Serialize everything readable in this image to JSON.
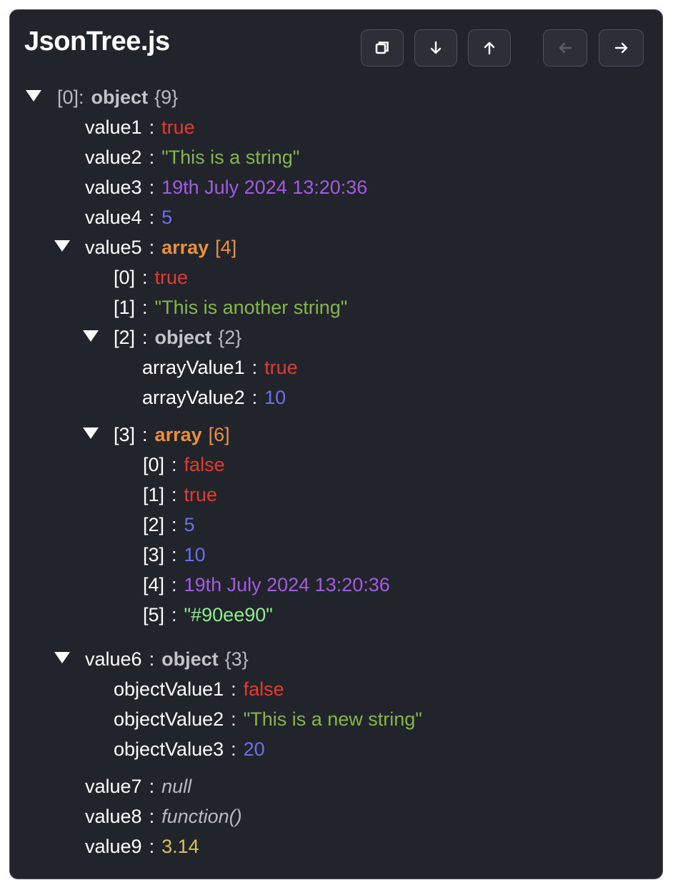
{
  "header": {
    "title": "JsonTree.js"
  },
  "toolbar": {
    "buttons": [
      {
        "name": "copy-button",
        "icon": "copy-icon",
        "enabled": true
      },
      {
        "name": "expand-all-button",
        "icon": "arrow-down-icon",
        "enabled": true
      },
      {
        "name": "collapse-all-button",
        "icon": "arrow-up-icon",
        "enabled": true
      },
      {
        "name": "previous-button",
        "icon": "arrow-left-icon",
        "enabled": false
      },
      {
        "name": "next-button",
        "icon": "arrow-right-icon",
        "enabled": true
      }
    ]
  },
  "tree": {
    "root": {
      "key": "[0]",
      "colon": ":",
      "type": "object",
      "count": "{9}"
    },
    "value1": {
      "key": "value1",
      "colon": ":",
      "value": "true"
    },
    "value2": {
      "key": "value2",
      "colon": ":",
      "value": "\"This is a string\""
    },
    "value3": {
      "key": "value3",
      "colon": ":",
      "value": "19th July 2024 13:20:36"
    },
    "value4": {
      "key": "value4",
      "colon": ":",
      "value": "5"
    },
    "value5": {
      "key": "value5",
      "colon": ":",
      "type": "array",
      "count": "[4]",
      "i0": {
        "key": "[0]",
        "colon": ":",
        "value": "true"
      },
      "i1": {
        "key": "[1]",
        "colon": ":",
        "value": "\"This is another string\""
      },
      "i2": {
        "key": "[2]",
        "colon": ":",
        "type": "object",
        "count": "{2}",
        "arrayValue1": {
          "key": "arrayValue1",
          "colon": ":",
          "value": "true"
        },
        "arrayValue2": {
          "key": "arrayValue2",
          "colon": ":",
          "value": "10"
        }
      },
      "i3": {
        "key": "[3]",
        "colon": ":",
        "type": "array",
        "count": "[6]",
        "j0": {
          "key": "[0]",
          "colon": ":",
          "value": "false"
        },
        "j1": {
          "key": "[1]",
          "colon": ":",
          "value": "true"
        },
        "j2": {
          "key": "[2]",
          "colon": ":",
          "value": "5"
        },
        "j3": {
          "key": "[3]",
          "colon": ":",
          "value": "10"
        },
        "j4": {
          "key": "[4]",
          "colon": ":",
          "value": "19th July 2024 13:20:36"
        },
        "j5": {
          "key": "[5]",
          "colon": ":",
          "value": "\"#90ee90\""
        }
      }
    },
    "value6": {
      "key": "value6",
      "colon": ":",
      "type": "object",
      "count": "{3}",
      "objectValue1": {
        "key": "objectValue1",
        "colon": ":",
        "value": "false"
      },
      "objectValue2": {
        "key": "objectValue2",
        "colon": ":",
        "value": "\"This is a new string\""
      },
      "objectValue3": {
        "key": "objectValue3",
        "colon": ":",
        "value": "20"
      }
    },
    "value7": {
      "key": "value7",
      "colon": ":",
      "value": "null"
    },
    "value8": {
      "key": "value8",
      "colon": ":",
      "value": "function()"
    },
    "value9": {
      "key": "value9",
      "colon": ":",
      "value": "3.14"
    }
  },
  "colors": {
    "background": "#22242b",
    "boolean": "#e33b2e",
    "string": "#84b64c",
    "date": "#a35be0",
    "number": "#6b71e8",
    "float": "#dcc14e",
    "array": "#ec8f3a",
    "color_string": "#90ee90"
  }
}
